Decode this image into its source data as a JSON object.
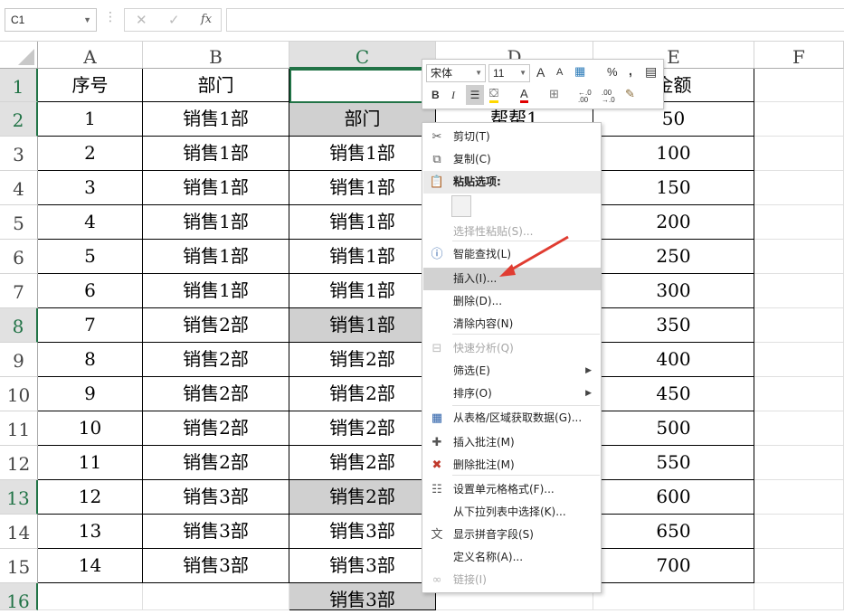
{
  "name_box": {
    "value": "C1"
  },
  "formula_bar": {
    "fx_label": "fx",
    "value": ""
  },
  "columns": [
    "A",
    "B",
    "C",
    "D",
    "E",
    "F"
  ],
  "rows": [
    {
      "num": "1",
      "a": "序号",
      "b": "部门",
      "c": "",
      "d": "",
      "e": "金额"
    },
    {
      "num": "2",
      "a": "1",
      "b": "销售1部",
      "c": "部门",
      "d": "帮帮1",
      "e": "50"
    },
    {
      "num": "3",
      "a": "2",
      "b": "销售1部",
      "c": "销售1部",
      "d": "",
      "e": "100"
    },
    {
      "num": "4",
      "a": "3",
      "b": "销售1部",
      "c": "销售1部",
      "d": "",
      "e": "150"
    },
    {
      "num": "5",
      "a": "4",
      "b": "销售1部",
      "c": "销售1部",
      "d": "",
      "e": "200"
    },
    {
      "num": "6",
      "a": "5",
      "b": "销售1部",
      "c": "销售1部",
      "d": "",
      "e": "250"
    },
    {
      "num": "7",
      "a": "6",
      "b": "销售1部",
      "c": "销售1部",
      "d": "",
      "e": "300"
    },
    {
      "num": "8",
      "a": "7",
      "b": "销售2部",
      "c": "销售1部",
      "d": "",
      "e": "350"
    },
    {
      "num": "9",
      "a": "8",
      "b": "销售2部",
      "c": "销售2部",
      "d": "",
      "e": "400"
    },
    {
      "num": "10",
      "a": "9",
      "b": "销售2部",
      "c": "销售2部",
      "d": "",
      "e": "450"
    },
    {
      "num": "11",
      "a": "10",
      "b": "销售2部",
      "c": "销售2部",
      "d": "",
      "e": "500"
    },
    {
      "num": "12",
      "a": "11",
      "b": "销售2部",
      "c": "销售2部",
      "d": "",
      "e": "550"
    },
    {
      "num": "13",
      "a": "12",
      "b": "销售3部",
      "c": "销售2部",
      "d": "",
      "e": "600"
    },
    {
      "num": "14",
      "a": "13",
      "b": "销售3部",
      "c": "销售3部",
      "d": "",
      "e": "650"
    },
    {
      "num": "15",
      "a": "14",
      "b": "销售3部",
      "c": "销售3部",
      "d": "",
      "e": "700"
    },
    {
      "num": "16",
      "a": "",
      "b": "",
      "c": "销售3部",
      "d": "",
      "e": ""
    }
  ],
  "mini_toolbar": {
    "font_name": "宋体",
    "font_size": "11",
    "grow_font": "A",
    "shrink_font": "A",
    "percent": "%",
    "comma": ",",
    "bold": "B",
    "italic": "I",
    "font_color_letter": "A",
    "inc_decimal": "←.0 .00",
    "dec_decimal": ".00 →.0"
  },
  "context_menu": {
    "items": [
      {
        "label": "剪切(T)",
        "icon": "scissors-icon"
      },
      {
        "label": "复制(C)",
        "icon": "copy-icon"
      },
      {
        "label": "粘贴选项:",
        "icon": "paste-icon"
      },
      {
        "label": "选择性粘贴(S)...",
        "icon": ""
      },
      {
        "label": "智能查找(L)",
        "icon": "smart-lookup-icon"
      },
      {
        "label": "插入(I)...",
        "icon": ""
      },
      {
        "label": "删除(D)...",
        "icon": ""
      },
      {
        "label": "清除内容(N)",
        "icon": ""
      },
      {
        "label": "快速分析(Q)",
        "icon": "quick-analysis-icon"
      },
      {
        "label": "筛选(E)",
        "icon": ""
      },
      {
        "label": "排序(O)",
        "icon": ""
      },
      {
        "label": "从表格/区域获取数据(G)...",
        "icon": "table-icon"
      },
      {
        "label": "插入批注(M)",
        "icon": "insert-comment-icon"
      },
      {
        "label": "删除批注(M)",
        "icon": "delete-comment-icon"
      },
      {
        "label": "设置单元格格式(F)...",
        "icon": "format-cells-icon"
      },
      {
        "label": "从下拉列表中选择(K)...",
        "icon": ""
      },
      {
        "label": "显示拼音字段(S)",
        "icon": "phonetic-icon"
      },
      {
        "label": "定义名称(A)...",
        "icon": ""
      },
      {
        "label": "链接(I)",
        "icon": "link-icon"
      }
    ]
  },
  "colors": {
    "accent": "#217346",
    "arrow": "#e03c31",
    "highlight": "#d0d0d0"
  }
}
